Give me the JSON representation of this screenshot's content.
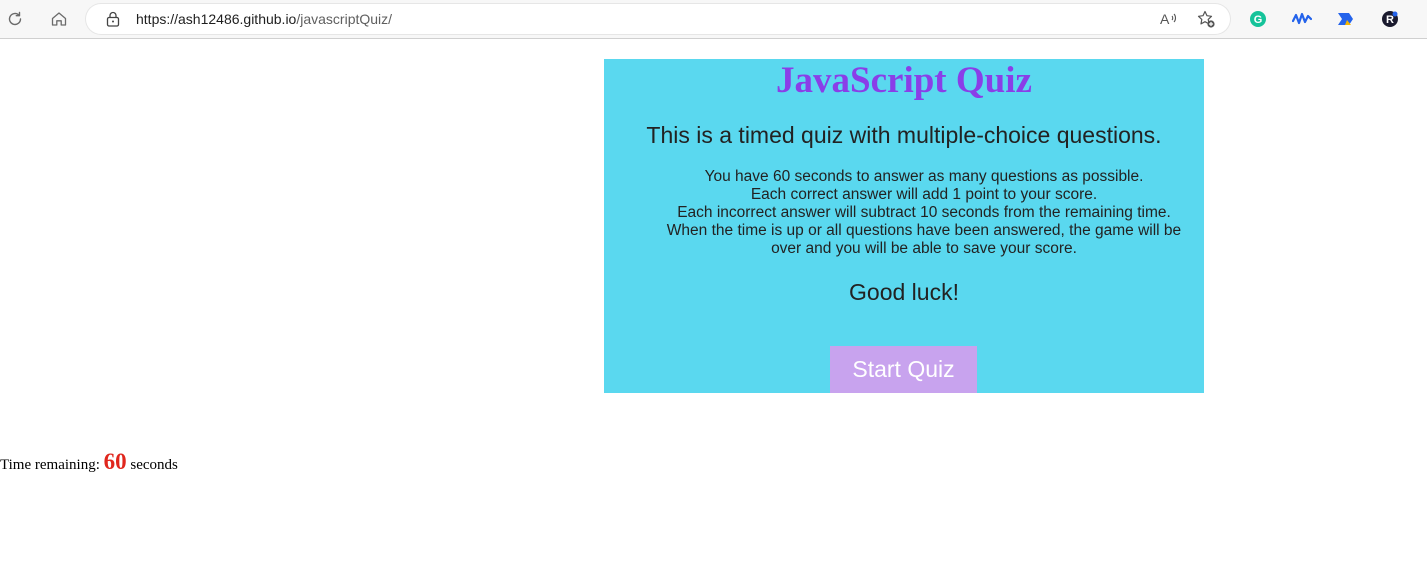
{
  "browser": {
    "url_host": "https://ash12486.github.io",
    "url_path": "/javascriptQuiz/",
    "icons": {
      "refresh": "refresh-icon",
      "home": "home-icon",
      "lock": "lock-icon",
      "read_aloud": "read-aloud-icon",
      "favorites": "add-favorite-icon",
      "grammarly": "grammarly-extension-icon",
      "ext2": "wave-extension-icon",
      "ext3": "bookmark-extension-icon",
      "ext4": "r-extension-icon"
    },
    "colors": {
      "grammarly": "#15c39a",
      "ext_blue": "#2463eb"
    }
  },
  "quiz": {
    "title": "JavaScript Quiz",
    "subtitle": "This is a timed quiz with multiple-choice questions.",
    "rules": [
      "You have 60 seconds to answer as many questions as possible.",
      "Each correct answer will add 1 point to your score.",
      "Each incorrect answer will subtract 10 seconds from the remaining time.",
      "When the time is up or all questions have been answered, the game will be over and you will be able to save your score."
    ],
    "good_luck": "Good luck!",
    "start_label": "Start Quiz",
    "colors": {
      "card_bg": "#5ad8ef",
      "title": "#8a3ee8",
      "button_bg": "#c8a3ee"
    }
  },
  "timer": {
    "prefix": "Time remaining: ",
    "value": "60",
    "suffix": " seconds",
    "value_color": "#e0261d"
  }
}
